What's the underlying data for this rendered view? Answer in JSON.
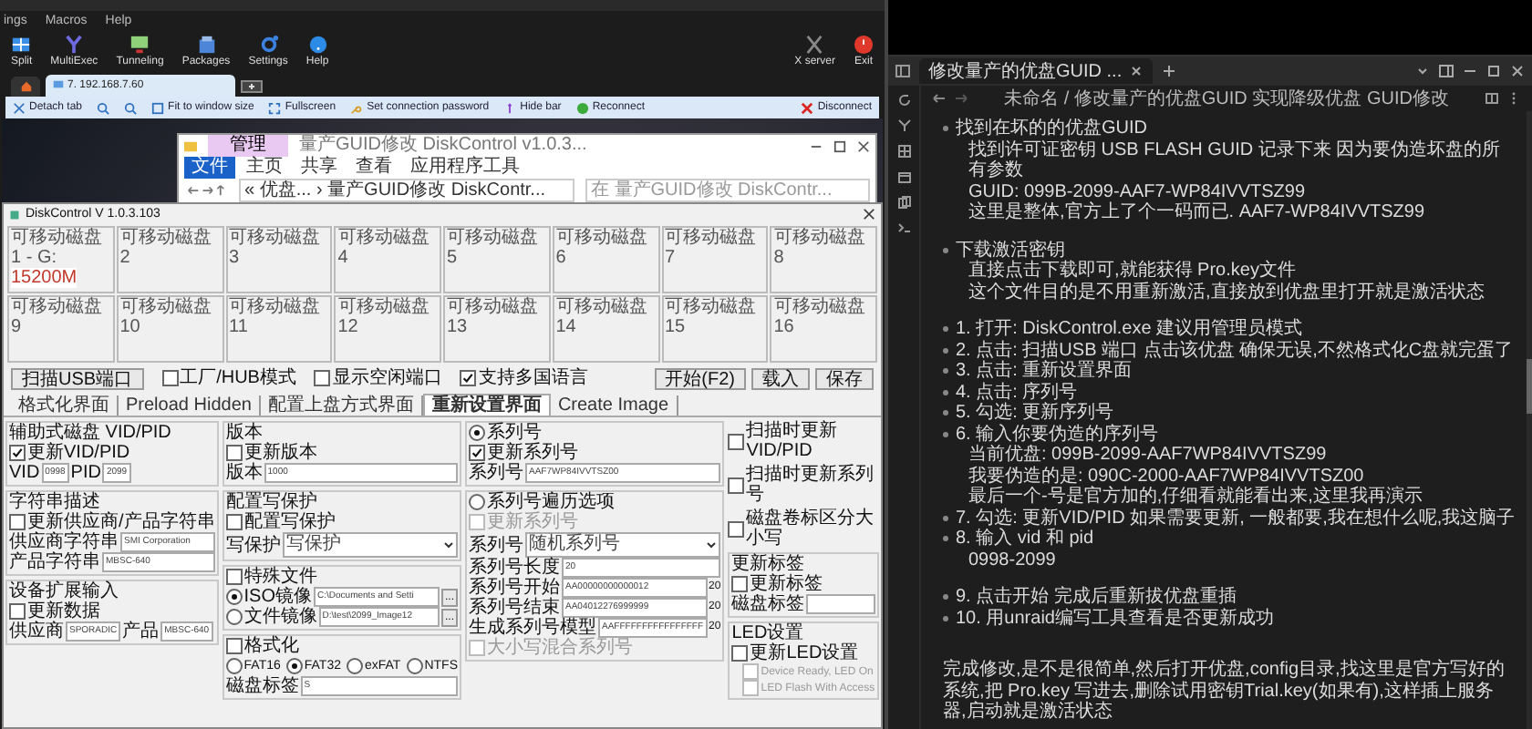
{
  "moba": {
    "menu": [
      "ings",
      "Macros",
      "Help"
    ],
    "toolbar": [
      "Split",
      "MultiExec",
      "Tunneling",
      "Packages",
      "Settings",
      "Help"
    ],
    "right_tools": [
      "X server",
      "Exit"
    ],
    "session_tab": "7. 192.168.7.60",
    "rdp_bar": [
      "Detach tab",
      "Fit to window size",
      "Fullscreen",
      "Set connection password",
      "Hide bar",
      "Reconnect"
    ],
    "disconnect": "Disconnect"
  },
  "explorer": {
    "title_tab": "管理",
    "title": "量产GUID修改 DiskControl v1.0.3...",
    "ribbon": [
      {
        "label": "文件",
        "selected": true
      },
      {
        "label": "主页",
        "selected": false
      },
      {
        "label": "共享",
        "selected": false
      },
      {
        "label": "查看",
        "selected": false
      },
      {
        "label": "应用程序工具",
        "selected": false
      }
    ],
    "address": "« 优盘... › 量产GUID修改 DiskContr...",
    "search_placeholder": "在 量产GUID修改 DiskContr..."
  },
  "disk_control": {
    "title": "DiskControl V 1.0.3.103",
    "disks": [
      {
        "label": "可移动磁盘 1 - G:",
        "size": "15200M"
      },
      {
        "label": "可移动磁盘 2"
      },
      {
        "label": "可移动磁盘 3"
      },
      {
        "label": "可移动磁盘 4"
      },
      {
        "label": "可移动磁盘 5"
      },
      {
        "label": "可移动磁盘 6"
      },
      {
        "label": "可移动磁盘 7"
      },
      {
        "label": "可移动磁盘 8"
      },
      {
        "label": "可移动磁盘 9"
      },
      {
        "label": "可移动磁盘 10"
      },
      {
        "label": "可移动磁盘 11"
      },
      {
        "label": "可移动磁盘 12"
      },
      {
        "label": "可移动磁盘 13"
      },
      {
        "label": "可移动磁盘 14"
      },
      {
        "label": "可移动磁盘 15"
      },
      {
        "label": "可移动磁盘 16"
      }
    ],
    "scan_button": "扫描USB端口",
    "options": [
      {
        "label": "工厂/HUB模式",
        "checked": false
      },
      {
        "label": "显示空闲端口",
        "checked": false
      },
      {
        "label": "支持多国语言",
        "checked": true
      }
    ],
    "tabs": [
      {
        "label": "格式化界面",
        "selected": false
      },
      {
        "label": "Preload Hidden",
        "selected": false
      },
      {
        "label": "配置上盘方式界面",
        "selected": false
      },
      {
        "label": "重新设置界面",
        "selected": true
      },
      {
        "label": "Create Image",
        "selected": false
      }
    ],
    "column_1": [
      {
        "head": {
          "kind": "text",
          "label": "辅助式磁盘 VID/PID"
        },
        "update": {
          "label": "更新VID/PID",
          "checked": true
        },
        "fields": [
          {
            "label": "VID",
            "value": "0998"
          },
          {
            "label": "PID",
            "value": "2099"
          }
        ]
      },
      {
        "head": {
          "kind": "text",
          "label": "字符串描述"
        },
        "update": {
          "label": "更新供应商/产品字符串",
          "checked": false
        },
        "fields": [
          {
            "label": "供应商字符串",
            "value": "SMI Corporation"
          },
          {
            "label": "产品字符串",
            "value": "MBSC-640"
          }
        ]
      },
      {
        "head": {
          "kind": "text",
          "label": "设备扩展输入"
        },
        "update": {
          "label": "更新数据",
          "checked": false
        },
        "fields": [
          {
            "label": "供应商",
            "value": "SPORADIC"
          },
          {
            "label": "产品",
            "value": "MBSC-640"
          }
        ]
      }
    ],
    "column_2": [
      {
        "head": {
          "kind": "text",
          "label": "版本"
        },
        "update": {
          "label": "更新版本",
          "checked": false
        },
        "fields": [
          {
            "label": "版本",
            "value": "1000"
          }
        ]
      },
      {
        "head": {
          "kind": "text",
          "label": "配置写保护"
        },
        "update": {
          "label": "配置写保护",
          "checked": false
        },
        "fields": [
          {
            "label": "写保护",
            "value": "写保护",
            "kind": "dropdown"
          }
        ]
      },
      {
        "head": {
          "kind": "checkbox",
          "label": "特殊文件",
          "checked": false
        },
        "fields": [
          {
            "label": "ISO镜像",
            "value": "C:\\Documents and Setti",
            "kind": "radio_path",
            "selected": true,
            "button": "..."
          },
          {
            "label": "文件镜像",
            "value": "D:\\test\\2099_Image12",
            "kind": "radio_path",
            "selected": false,
            "button": "..."
          }
        ]
      },
      {
        "head": {
          "kind": "checkbox",
          "label": "格式化",
          "checked": false
        },
        "radios": [
          {
            "label": "FAT16",
            "selected": false
          },
          {
            "label": "FAT32",
            "selected": true
          },
          {
            "label": "exFAT",
            "selected": false
          },
          {
            "label": "NTFS",
            "selected": false
          }
        ],
        "fields": [
          {
            "label": "磁盘标签",
            "value": "S"
          }
        ]
      }
    ],
    "column_3": [
      {
        "head": {
          "kind": "radio",
          "label": "系列号",
          "selected": true
        },
        "update": {
          "label": "更新系列号",
          "checked": true
        },
        "fields": [
          {
            "label": "系列号",
            "value": "AAF7WP84IVVTSZ00"
          }
        ]
      },
      {
        "head": {
          "kind": "radio",
          "label": "系列号遍历选项",
          "selected": false
        },
        "update": {
          "label": "更新系列号",
          "checked": false,
          "disabled": true
        },
        "fields": [
          {
            "label": "系列号",
            "value": "随机系列号",
            "kind": "dropdown"
          },
          {
            "label": "系列号长度",
            "value": "20"
          },
          {
            "label": "系列号开始",
            "value": "AA00000000000012",
            "suffix": "20"
          },
          {
            "label": "系列号结束",
            "value": "AA04012276999999",
            "suffix": "20"
          },
          {
            "label": "生成系列号模型",
            "value": "AAFFFFFFFFFFFFFFFF",
            "suffix": "20"
          }
        ],
        "extra": {
          "label": "大小写混合系列号",
          "checked": false,
          "disabled": true
        }
      }
    ],
    "scan_options": [
      {
        "label": "扫描时更新VID/PID",
        "checked": false
      },
      {
        "label": "扫描时更新系列号",
        "checked": false
      },
      {
        "label": "磁盘卷标区分大小写",
        "checked": false
      }
    ],
    "buttons": [
      "开始(F2)",
      "载入",
      "保存"
    ],
    "column_4": [
      {
        "head": {
          "kind": "text",
          "label": "更新标签"
        },
        "update": {
          "label": "更新标签",
          "checked": false
        },
        "fields": [
          {
            "label": "磁盘标签"
          }
        ]
      },
      {
        "head": {
          "kind": "text",
          "label": "LED设置"
        },
        "update": {
          "label": "更新LED设置",
          "checked": false
        },
        "checks": [
          {
            "label": "Device Ready, LED On",
            "checked": false,
            "disabled": true
          },
          {
            "label": "LED Flash With Access",
            "checked": false,
            "disabled": true
          }
        ]
      }
    ]
  },
  "notes": {
    "tab": "修改量产的优盘GUID ...",
    "breadcrumb": "未命名 / 修改量产的优盘GUID 实现降级优盘 GUID修改",
    "sections": [
      [
        {
          "text": "找到在坏的的优盘GUID",
          "lines": [
            "找到许可证密钥 USB FLASH GUID 记录下来 因为要伪造坏盘的所有参数",
            "GUID: 099B-2099-AAF7-WP84IVVTSZ99",
            "这里是整体,官方上了个一码而已. AAF7-WP84IVVTSZ99"
          ]
        }
      ],
      [
        {
          "text": "下载激活密钥",
          "lines": [
            "直接点击下载即可,就能获得 Pro.key文件",
            "这个文件目的是不用重新激活,直接放到优盘里打开就是激活状态"
          ]
        }
      ],
      [
        {
          "text": "1. 打开: DiskControl.exe 建议用管理员模式"
        },
        {
          "text": "2. 点击: 扫描USB 端口 点击该优盘 确保无误,不然格式化C盘就完蛋了"
        },
        {
          "text": "3. 点击: 重新设置界面"
        },
        {
          "text": "4. 点击: 序列号"
        },
        {
          "text": "5. 勾选: 更新序列号"
        },
        {
          "text": "6. 输入你要伪造的序列号",
          "lines": [
            "当前优盘: 099B-2099-AAF7WP84IVVTSZ99",
            "我要伪造的是: 090C-2000-AAF7WP84IVVTSZ00",
            "最后一个-号是官方加的,仔细看就能看出来,这里我再演示"
          ]
        },
        {
          "text": "7. 勾选: 更新VID/PID 如果需要更新, 一般都要,我在想什么呢,我这脑子"
        },
        {
          "text": "8. 输入 vid 和 pid",
          "lines": [
            "0998-2099"
          ]
        }
      ],
      [
        {
          "text": "9. 点击开始 完成后重新拔优盘重插"
        },
        {
          "text": "10. 用unraid编写工具查看是否更新成功"
        }
      ]
    ],
    "paragraph": "完成修改,是不是很简单,然后打开优盘,config目录,找这里是官方写好的系统,把 Pro.key 写进去,删除试用密钥Trial.key(如果有),这样插上服务器,启动就是激活状态"
  }
}
